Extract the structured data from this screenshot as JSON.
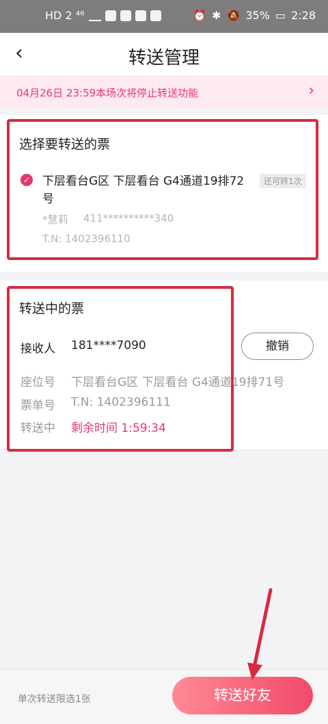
{
  "status_bar": {
    "left_text": "HD 2 ⁴⁶",
    "battery": "35%",
    "time": "2:28"
  },
  "header": {
    "title": "转送管理"
  },
  "notice": {
    "text": "04月26日 23:59本场次将停止转送功能"
  },
  "select_section": {
    "title": "选择要转送的票",
    "ticket": {
      "seat": "下层看台G区 下层看台 G4通道19排72号",
      "badge": "还可转1次",
      "holder": "*慧莉",
      "id_number": "411**********340",
      "tn": "T.N: 1402396110"
    }
  },
  "transferring_section": {
    "title": "转送中的票",
    "receiver_label": "接收人",
    "receiver_value": "181****7090",
    "cancel_label": "撤销",
    "seat_label": "座位号",
    "seat_value": "下层看台G区 下层看台 G4通道19排71号",
    "order_label": "票单号",
    "order_value": "T.N: 1402396111",
    "status_label": "转送中",
    "status_value": "剩余时间 1:59:34"
  },
  "footer": {
    "limit_text": "单次转送限选1张",
    "send_button": "转送好友"
  },
  "colors": {
    "accent": "#e5396b",
    "highlight_box": "#d72a3e"
  }
}
